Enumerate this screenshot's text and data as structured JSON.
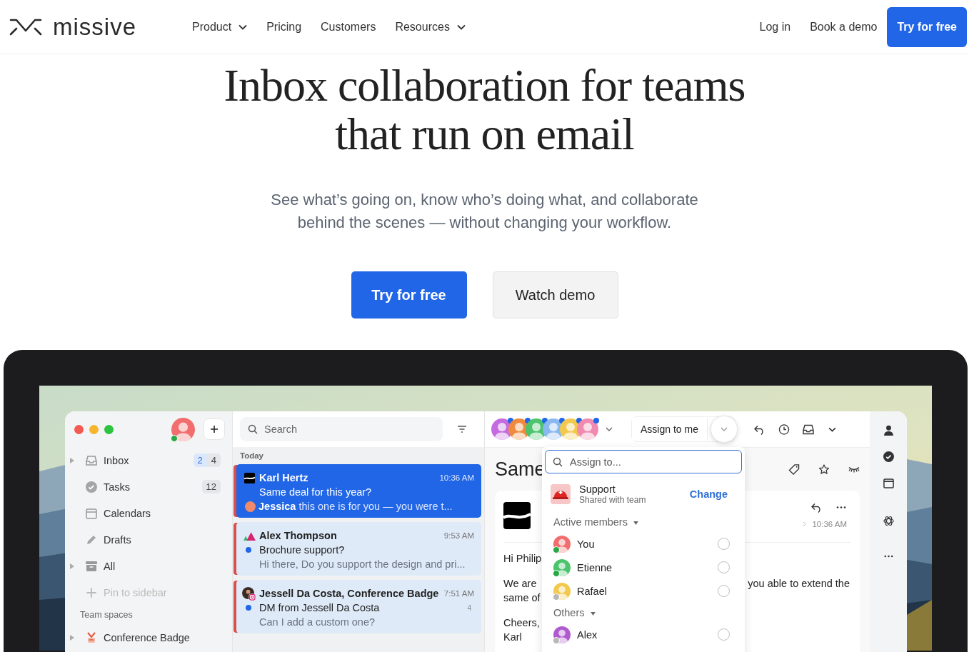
{
  "nav": {
    "brand": "missive",
    "links": [
      {
        "label": "Product",
        "dropdown": true
      },
      {
        "label": "Pricing",
        "dropdown": false
      },
      {
        "label": "Customers",
        "dropdown": false
      },
      {
        "label": "Resources",
        "dropdown": true
      }
    ],
    "actions": [
      {
        "label": "Log in",
        "kind": "link"
      },
      {
        "label": "Book a demo",
        "kind": "link"
      },
      {
        "label": "Try for free",
        "kind": "primary"
      }
    ]
  },
  "hero": {
    "title_lines": [
      "Inbox collaboration for teams",
      "that run on email"
    ],
    "subtitle_lines": [
      "See what’s going on, know who’s doing what, and collaborate",
      "behind the scenes — without changing your workflow."
    ],
    "buttons": [
      {
        "label": "Try for free",
        "kind": "primary"
      },
      {
        "label": "Watch demo",
        "kind": "secondary"
      }
    ]
  },
  "app": {
    "sidebar": {
      "user_online": true,
      "items": [
        {
          "label": "Inbox",
          "kind": "inbox",
          "expandable": true,
          "counts": [
            {
              "text": "2",
              "kind": "unread"
            },
            {
              "text": "4",
              "kind": "total"
            }
          ]
        },
        {
          "label": "Tasks",
          "kind": "tasks",
          "expandable": false,
          "counts": [
            {
              "text": "12",
              "kind": "total"
            }
          ]
        },
        {
          "label": "Calendars",
          "kind": "calendar",
          "expandable": false
        },
        {
          "label": "Drafts",
          "kind": "pencil",
          "expandable": false
        },
        {
          "label": "All",
          "kind": "archive",
          "expandable": true
        }
      ],
      "pin_label": "Pin to sidebar",
      "section_title": "Team spaces",
      "team_spaces": [
        {
          "label": "Conference Badge",
          "expandable": true
        }
      ]
    },
    "search": {
      "placeholder": "Search"
    },
    "list": {
      "group": "Today",
      "conversations": [
        {
          "kind": "wave",
          "sender": "Karl Hertz",
          "time": "10:36 AM",
          "subject": "Same deal for this year?",
          "preview": "**Jessica** this one is for you — you were t...",
          "preview_avatar": true,
          "unread": false,
          "selected": true
        },
        {
          "kind": "triangles",
          "sender": "Alex Thompson",
          "time": "9:53 AM",
          "subject": "Brochure support?",
          "preview": "Hi there, Do you support the design and pri...",
          "preview_avatar": false,
          "unread": true,
          "selected": false
        },
        {
          "kind": "instagram",
          "sender": "Jessell Da Costa, Conference Badge",
          "time": "7:51 AM",
          "subject": "DM from Jessell Da Costa",
          "count": "4",
          "preview": "Can I add a custom one?",
          "preview_avatar": false,
          "unread": true,
          "selected": false
        }
      ]
    },
    "conversation": {
      "watchers": [
        {
          "color": "#c46be0"
        },
        {
          "color": "#f08a3c"
        },
        {
          "color": "#4cc46c"
        },
        {
          "color": "#8ab8f0"
        },
        {
          "color": "#f2c94c"
        },
        {
          "color": "#f08ab0"
        }
      ],
      "assign_button": "Assign to me",
      "title": "Same",
      "message": {
        "time": "10:36 AM",
        "paragraphs": [
          {
            "lines": [
              {
                "left": "Hi Philip"
              }
            ]
          },
          {
            "lines": [
              {
                "left": "We are",
                "right": "you able to extend the"
              },
              {
                "left": "same of"
              }
            ]
          },
          {
            "lines": [
              {
                "left": "Cheers,"
              },
              {
                "left": "Karl"
              }
            ]
          }
        ]
      },
      "assign_menu": {
        "placeholder": "Assign to...",
        "team": {
          "name": "Support",
          "note": "Shared with team",
          "action": "Change"
        },
        "groups": [
          {
            "title": "Active members",
            "members": [
              {
                "name": "You",
                "color": "#f26d6d",
                "online": true,
                "checked": false
              },
              {
                "name": "Etienne",
                "color": "#4cc46c",
                "online": true,
                "checked": false
              },
              {
                "name": "Rafael",
                "color": "#f2c94c",
                "online": false,
                "checked": false
              }
            ]
          },
          {
            "title": "Others",
            "members": [
              {
                "name": "Alex",
                "color": "#b05ad0",
                "online": false,
                "checked": false
              }
            ]
          }
        ]
      }
    }
  }
}
